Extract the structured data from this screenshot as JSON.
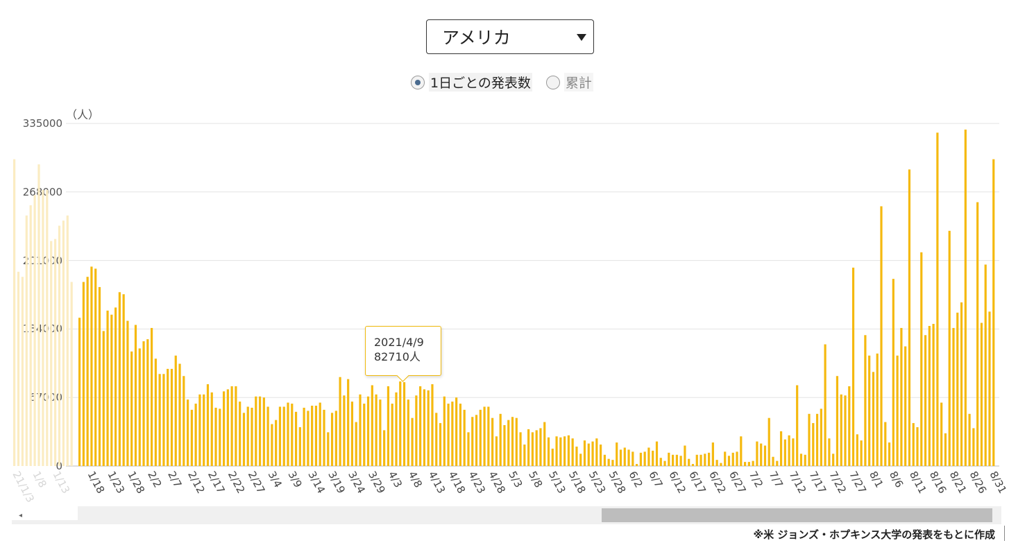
{
  "selector": {
    "value": "アメリカ"
  },
  "radios": [
    {
      "label": "1日ごとの発表数",
      "checked": true
    },
    {
      "label": "累計",
      "checked": false
    }
  ],
  "source_note": "※米 ジョンズ・ホプキンス大学の発表をもとに作成",
  "tooltip": {
    "date": "2021/4/9",
    "value": "82710人"
  },
  "colors": {
    "bar": "#f5b90f",
    "grid": "#e3e3e3"
  },
  "chart_data": {
    "type": "bar",
    "unit": "（人）",
    "ylim": [
      0,
      335000
    ],
    "yticks": [
      0,
      67000,
      134000,
      201000,
      268000,
      335000
    ],
    "xtick_labels": [
      "1/18",
      "1/23",
      "1/28",
      "2/2",
      "2/7",
      "2/12",
      "2/17",
      "2/22",
      "2/27",
      "3/4",
      "3/9",
      "3/14",
      "3/19",
      "3/24",
      "3/29",
      "4/3",
      "4/8",
      "4/13",
      "4/18",
      "4/23",
      "4/28",
      "5/3",
      "5/8",
      "5/13",
      "5/18",
      "5/23",
      "5/28",
      "6/2",
      "6/7",
      "6/12",
      "6/17",
      "6/22",
      "6/27",
      "7/2",
      "7/7",
      "7/12",
      "7/17",
      "7/22",
      "7/27",
      "8/1",
      "8/6",
      "8/11",
      "8/16",
      "8/21",
      "8/26",
      "8/31"
    ],
    "faded_xtick_labels": [
      "21/1/3",
      "1/8",
      "1/13"
    ],
    "start_date": "1/16",
    "values": [
      145000,
      180000,
      185000,
      195000,
      193000,
      175000,
      132000,
      152000,
      148000,
      155000,
      170000,
      168000,
      142000,
      112000,
      138000,
      115000,
      122000,
      124000,
      135000,
      105000,
      90000,
      90000,
      95000,
      95000,
      108000,
      100000,
      88000,
      65000,
      55000,
      61000,
      70000,
      70000,
      80000,
      72000,
      57000,
      56000,
      73000,
      75000,
      78000,
      78000,
      63000,
      52000,
      58000,
      57000,
      68000,
      68000,
      67000,
      58000,
      41000,
      45000,
      58000,
      58000,
      62000,
      61000,
      53000,
      38000,
      57000,
      54000,
      59000,
      59000,
      62000,
      55000,
      33000,
      52000,
      54000,
      87000,
      69000,
      85000,
      63000,
      43000,
      70000,
      61000,
      68000,
      79000,
      70000,
      65000,
      35000,
      78000,
      61000,
      72000,
      82710,
      82000,
      65000,
      47000,
      69000,
      78000,
      75000,
      74000,
      80000,
      52000,
      42000,
      68000,
      61000,
      63000,
      67000,
      61000,
      55000,
      33000,
      48000,
      50000,
      55000,
      58000,
      58000,
      47000,
      29000,
      51000,
      40000,
      45000,
      48000,
      47000,
      33000,
      21000,
      36000,
      33000,
      35000,
      37000,
      43000,
      28000,
      17000,
      29000,
      28000,
      29000,
      30000,
      27000,
      19000,
      12000,
      25000,
      22000,
      24000,
      27000,
      21000,
      11000,
      7000,
      6000,
      23000,
      16000,
      18000,
      16000,
      14000,
      2000,
      13000,
      14000,
      18000,
      15000,
      24000,
      8000,
      5000,
      13000,
      11000,
      11000,
      10000,
      20000,
      7000,
      2000,
      11000,
      11000,
      12000,
      13000,
      23000,
      6000,
      3000,
      14000,
      10000,
      13000,
      14000,
      29000,
      4000,
      4000,
      5000,
      24000,
      22000,
      20000,
      47000,
      9000,
      5000,
      34000,
      26000,
      30000,
      27000,
      79000,
      12000,
      11000,
      51000,
      42000,
      51000,
      56000,
      119000,
      27000,
      12000,
      88000,
      70000,
      69000,
      78000,
      194000,
      31000,
      25000,
      128000,
      108000,
      92000,
      110000,
      254000,
      43000,
      23000,
      183000,
      108000,
      135000,
      117000,
      290000,
      42000,
      38000,
      209000,
      128000,
      137000,
      139000,
      326000,
      62000,
      32000,
      230000,
      135000,
      150000,
      160000,
      329000,
      51000,
      37000,
      258000,
      140000,
      197000,
      151000,
      300000
    ]
  }
}
